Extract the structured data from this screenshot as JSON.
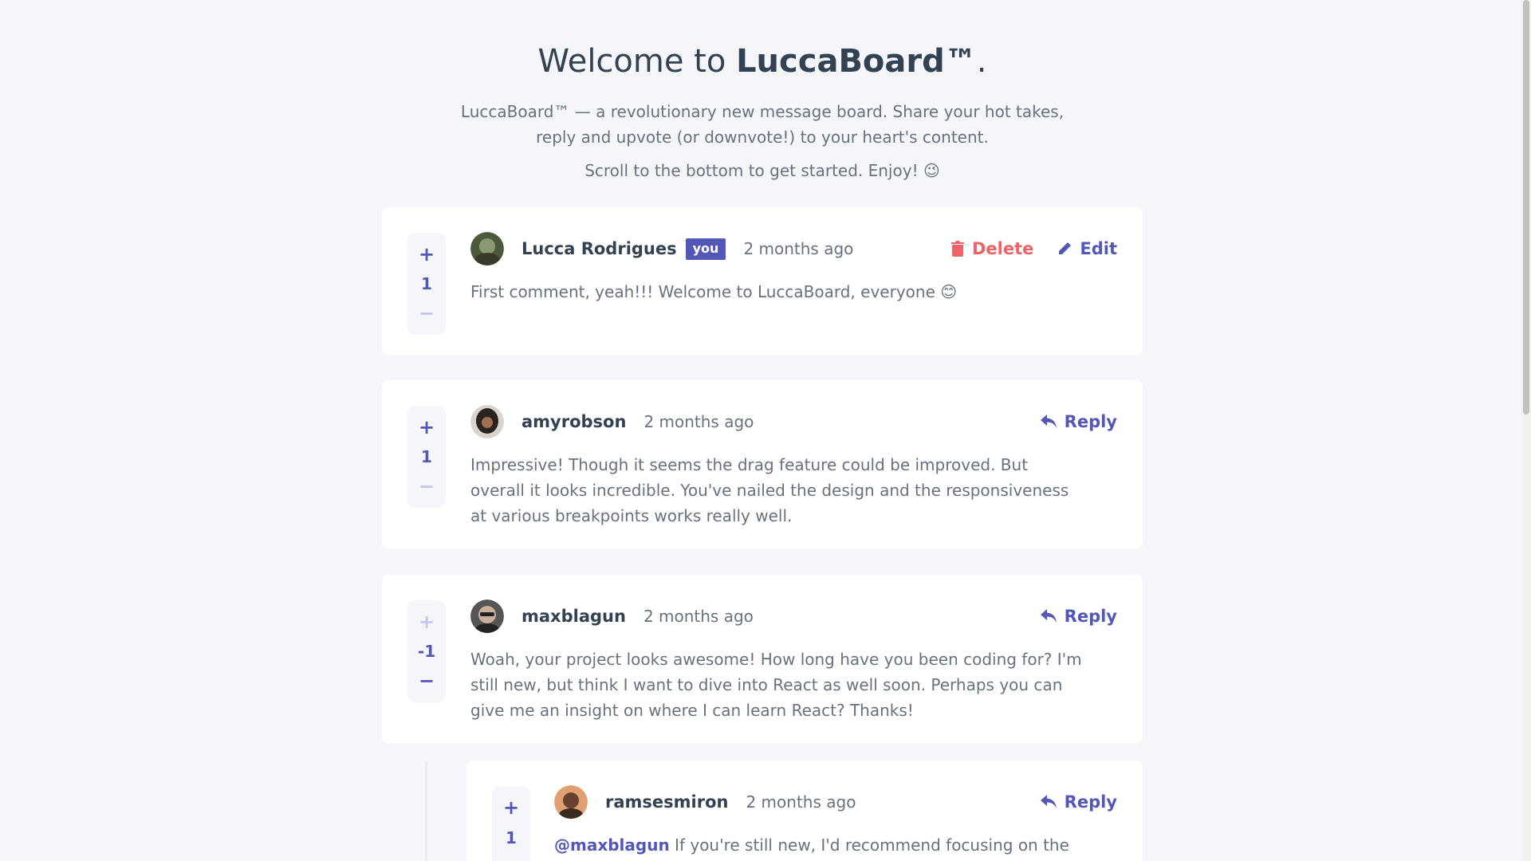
{
  "hero": {
    "title_prefix": "Welcome to ",
    "title_brand": "LuccaBoard™",
    "title_suffix": ".",
    "subtitle_line1": "LuccaBoard™ — a revolutionary new message board. Share your hot takes,",
    "subtitle_line2": "reply and upvote (or downvote!) to your heart's content.",
    "subtitle2": "Scroll to the bottom to get started. Enjoy! 😉"
  },
  "comments": [
    {
      "username": "Lucca Rodrigues",
      "badge": "you",
      "time": "2 months ago",
      "score": "1",
      "upvote": "+",
      "downvote": "−",
      "delete_label": "Delete",
      "edit_label": "Edit",
      "text": "First comment, yeah!!! Welcome to LuccaBoard, everyone 😊"
    },
    {
      "username": "amyrobson",
      "time": "2 months ago",
      "score": "1",
      "upvote": "+",
      "downvote": "−",
      "reply_label": "Reply",
      "text": "Impressive! Though it seems the drag feature could be improved. But overall it looks incredible. You've nailed the design and the responsiveness at various breakpoints works really well."
    },
    {
      "username": "maxblagun",
      "time": "2 months ago",
      "score": "-1",
      "upvote": "+",
      "downvote": "−",
      "reply_label": "Reply",
      "text": "Woah, your project looks awesome! How long have you been coding for? I'm still new, but think I want to dive into React as well soon. Perhaps you can give me an insight on where I can learn React? Thanks!"
    }
  ],
  "replies": [
    {
      "username": "ramsesmiron",
      "time": "2 months ago",
      "score": "1",
      "upvote": "+",
      "reply_label": "Reply",
      "mention": "@maxblagun",
      "text": " If you're still new, I'd recommend focusing on the"
    }
  ],
  "colors": {
    "accent": "#5357b6",
    "danger": "#ed6368",
    "background": "#f5f6fa",
    "heading": "#334253",
    "body": "#67727e"
  }
}
